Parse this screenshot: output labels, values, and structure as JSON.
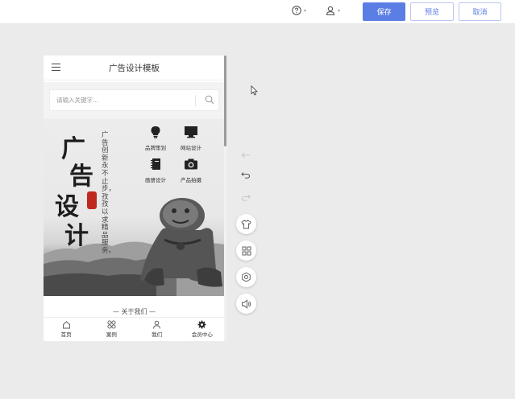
{
  "toolbar": {
    "help_icon": "question-circle-icon",
    "user_icon": "user-icon",
    "save_label": "保存",
    "preview_label": "预览",
    "cancel_label": "取消",
    "accent": "#5b7ee5"
  },
  "phone": {
    "title": "广告设计模板",
    "search_placeholder": "请输入关键字...",
    "banner": {
      "calligraphy": [
        "广",
        "告",
        "设",
        "计"
      ],
      "vertical_text": "广告创新永不止步，孜孜以求精品服务。",
      "features": [
        {
          "label": "品牌策划",
          "icon": "lightbulb-icon"
        },
        {
          "label": "网站设计",
          "icon": "monitor-icon"
        },
        {
          "label": "画册设计",
          "icon": "notebook-icon"
        },
        {
          "label": "产品拍摄",
          "icon": "camera-icon"
        }
      ]
    },
    "about_label": "— 关于我们 —",
    "nav": [
      {
        "label": "首页",
        "icon": "home-icon"
      },
      {
        "label": "案例",
        "icon": "grid-icon"
      },
      {
        "label": "我们",
        "icon": "person-icon"
      },
      {
        "label": "会员中心",
        "icon": "gear-icon"
      }
    ]
  }
}
